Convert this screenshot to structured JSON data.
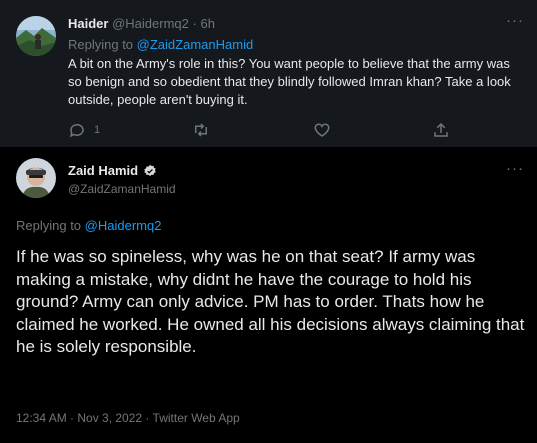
{
  "reply_tweet": {
    "author_name": "Haider",
    "author_handle": "@Haidermq2",
    "separator": "·",
    "time": "6h",
    "replying_prefix": "Replying to",
    "replying_to": "@ZaidZamanHamid",
    "text": "A bit on the Army's role in this? You want people to believe that the army was so benign and so obedient that they blindly followed Imran khan? Take a look outside, people aren't buying it.",
    "reply_count": "1",
    "more": "···"
  },
  "main_tweet": {
    "author_name": "Zaid Hamid",
    "author_handle": "@ZaidZamanHamid",
    "replying_prefix": "Replying to",
    "replying_to": "@Haidermq2",
    "text": "If he was so spineless, why was he on that seat? If army was making a mistake, why didnt he have the courage to hold his ground? Army can only advice. PM has to order. Thats how he claimed he worked. He owned all his decisions always claiming that he is solely responsible.",
    "timestamp": "12:34 AM · Nov 3, 2022 · Twitter Web App",
    "more": "···"
  },
  "colors": {
    "background": "#000000",
    "reply_background": "#15181c",
    "text": "#e7e9ea",
    "muted": "#71767b",
    "link": "#1d9bf0",
    "verified": "#d6d9db"
  },
  "icons": [
    "more-icon",
    "reply-icon",
    "retweet-icon",
    "like-icon",
    "share-icon",
    "verified-badge-icon"
  ]
}
